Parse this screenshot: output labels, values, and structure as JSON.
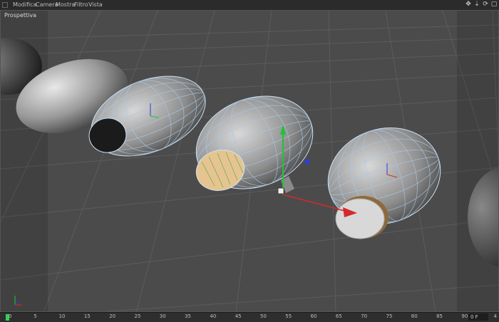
{
  "menubar": {
    "items": [
      "Modifica",
      "Camera",
      "Mostra",
      "Filtro",
      "Vista"
    ],
    "icons": [
      "move-view-icon",
      "zoom-view-icon",
      "rotate-view-icon",
      "maximize-view-icon"
    ]
  },
  "viewport": {
    "label": "Prospettiva",
    "axis_gizmo_labels": [
      "Y",
      "Z",
      "X"
    ]
  },
  "timeline": {
    "ticks": [
      "0",
      "5",
      "10",
      "15",
      "20",
      "25",
      "30",
      "35",
      "40",
      "45",
      "50",
      "55",
      "60",
      "65",
      "70",
      "75",
      "80",
      "85",
      "90"
    ],
    "current_frame": "0 F",
    "end_marker": "4"
  },
  "colors": {
    "viewport_bg": "#4b4b4b",
    "grid": "#5a5a5a",
    "wire": "#a8c8e6",
    "axis_y": "#1ec43a",
    "axis_x": "#d42a2a",
    "axis_z": "#2a40d6",
    "cut_face": "#e6c48f"
  }
}
